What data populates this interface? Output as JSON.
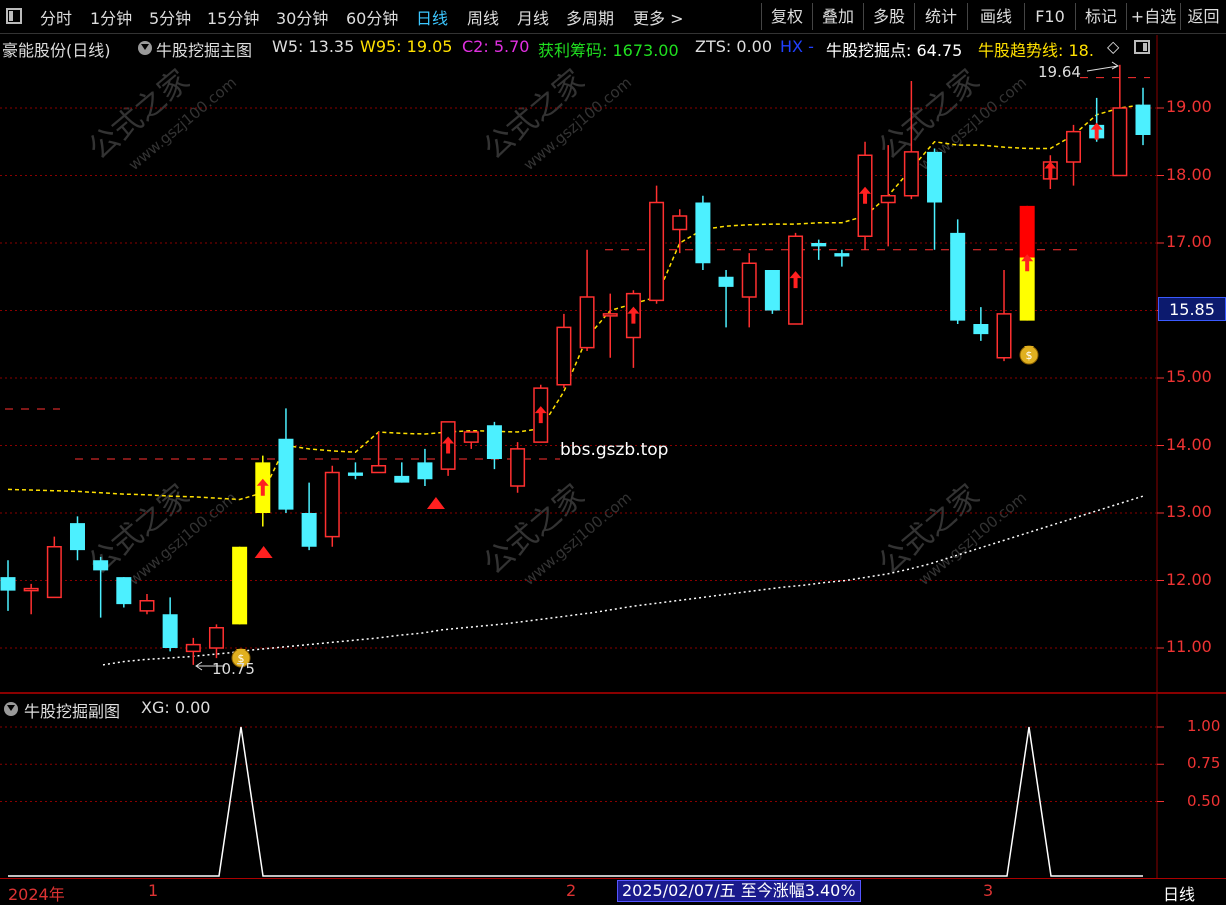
{
  "toolbar": {
    "periods": [
      "分时",
      "1分钟",
      "5分钟",
      "15分钟",
      "30分钟",
      "60分钟",
      "日线",
      "周线",
      "月线",
      "多周期",
      "更多 >"
    ],
    "active_period": "日线",
    "actions": [
      "复权",
      "叠加",
      "多股",
      "统计",
      "画线",
      "F10",
      "标记",
      "+自选",
      "返回"
    ]
  },
  "info": {
    "stock": "豪能股份(日线)",
    "main_indicator": "牛股挖掘主图",
    "w5": "W5: 13.35",
    "w95": "W95: 19.05",
    "c2": "C2: 5.70",
    "profit": "获利筹码: 1673.00",
    "zts": "ZTS: 0.00",
    "hx": "HX -",
    "dig_point": "牛股挖掘点: 64.75",
    "trend_line": "牛股趋势线: 18.",
    "diamond": "◇"
  },
  "sub": {
    "indicator": "牛股挖掘副图",
    "xg": "XG: 0.00"
  },
  "price_tag": "15.85",
  "watermark_url": "bbs.gszb.top",
  "watermark_text": [
    "公式之家",
    "www.gszj100.com"
  ],
  "main_axis_labels": [
    "19.00",
    "18.00",
    "17.00",
    "15.00",
    "14.00",
    "13.00",
    "12.00",
    "11.00"
  ],
  "sub_axis_labels": [
    "1.00",
    "0.75",
    "0.50"
  ],
  "date_bar": {
    "labels": [
      "2024年",
      "1",
      "2",
      "3"
    ],
    "highlight": "2025/02/07/五  至今涨幅3.40%",
    "period": "日线"
  },
  "annotations": {
    "high_label": "19.64",
    "low_label": "10.75"
  },
  "colors": {
    "up": "#ff3030",
    "down": "#4cf0ff",
    "signal_top": "#ff0000",
    "signal_bottom": "#ffff00",
    "ma_yellow": "#ffe000",
    "ma_white": "#ffffff",
    "grid": "#8a0000"
  },
  "chart_data": [
    {
      "type": "candlestick",
      "title": "豪能股份(日线)",
      "ylim": [
        10.5,
        19.6
      ],
      "candles": [
        {
          "o": 12.05,
          "h": 12.3,
          "l": 11.55,
          "c": 11.85
        },
        {
          "o": 11.85,
          "h": 11.95,
          "l": 11.5,
          "c": 11.88
        },
        {
          "o": 11.75,
          "h": 12.65,
          "l": 11.75,
          "c": 12.5
        },
        {
          "o": 12.85,
          "h": 12.95,
          "l": 12.3,
          "c": 12.45
        },
        {
          "o": 12.3,
          "h": 12.35,
          "l": 11.45,
          "c": 12.15
        },
        {
          "o": 12.05,
          "h": 12.05,
          "l": 11.6,
          "c": 11.65
        },
        {
          "o": 11.55,
          "h": 11.8,
          "l": 11.5,
          "c": 11.7
        },
        {
          "o": 11.5,
          "h": 11.75,
          "l": 10.95,
          "c": 11.0
        },
        {
          "o": 10.95,
          "h": 11.15,
          "l": 10.75,
          "c": 11.05
        },
        {
          "o": 11.0,
          "h": 11.35,
          "l": 10.85,
          "c": 11.3
        },
        {
          "o": 11.35,
          "h": 12.5,
          "l": 11.35,
          "c": 12.5,
          "signal": "yellow"
        },
        {
          "o": 13.0,
          "h": 13.85,
          "l": 12.8,
          "c": 13.75,
          "signal": "yellow"
        },
        {
          "o": 14.1,
          "h": 14.55,
          "l": 13.0,
          "c": 13.05
        },
        {
          "o": 13.0,
          "h": 13.45,
          "l": 12.45,
          "c": 12.5
        },
        {
          "o": 12.65,
          "h": 13.7,
          "l": 12.5,
          "c": 13.6
        },
        {
          "o": 13.6,
          "h": 13.75,
          "l": 13.5,
          "c": 13.55
        },
        {
          "o": 13.6,
          "h": 14.2,
          "l": 13.6,
          "c": 13.7
        },
        {
          "o": 13.55,
          "h": 13.75,
          "l": 13.45,
          "c": 13.45
        },
        {
          "o": 13.75,
          "h": 13.95,
          "l": 13.4,
          "c": 13.5
        },
        {
          "o": 13.65,
          "h": 14.35,
          "l": 13.55,
          "c": 14.35
        },
        {
          "o": 14.05,
          "h": 14.2,
          "l": 13.95,
          "c": 14.2
        },
        {
          "o": 14.3,
          "h": 14.35,
          "l": 13.65,
          "c": 13.8
        },
        {
          "o": 13.4,
          "h": 14.05,
          "l": 13.3,
          "c": 13.95
        },
        {
          "o": 14.05,
          "h": 14.9,
          "l": 14.05,
          "c": 14.85
        },
        {
          "o": 14.9,
          "h": 15.95,
          "l": 14.85,
          "c": 15.75
        },
        {
          "o": 15.45,
          "h": 16.9,
          "l": 15.4,
          "c": 16.2
        },
        {
          "o": 15.95,
          "h": 16.25,
          "l": 15.3,
          "c": 15.95
        },
        {
          "o": 15.6,
          "h": 16.3,
          "l": 15.15,
          "c": 16.25
        },
        {
          "o": 16.15,
          "h": 17.85,
          "l": 16.1,
          "c": 17.6
        },
        {
          "o": 17.2,
          "h": 17.5,
          "l": 16.85,
          "c": 17.4
        },
        {
          "o": 17.6,
          "h": 17.7,
          "l": 16.6,
          "c": 16.7
        },
        {
          "o": 16.5,
          "h": 16.6,
          "l": 15.75,
          "c": 16.35
        },
        {
          "o": 16.2,
          "h": 16.85,
          "l": 15.75,
          "c": 16.7
        },
        {
          "o": 16.6,
          "h": 16.6,
          "l": 15.95,
          "c": 16.0
        },
        {
          "o": 15.8,
          "h": 17.15,
          "l": 15.8,
          "c": 17.1
        },
        {
          "o": 17.0,
          "h": 17.05,
          "l": 16.75,
          "c": 16.95
        },
        {
          "o": 16.85,
          "h": 16.9,
          "l": 16.65,
          "c": 16.8
        },
        {
          "o": 17.1,
          "h": 18.5,
          "l": 16.9,
          "c": 18.3
        },
        {
          "o": 17.6,
          "h": 18.45,
          "l": 16.95,
          "c": 17.7
        },
        {
          "o": 17.7,
          "h": 19.4,
          "l": 17.65,
          "c": 18.35
        },
        {
          "o": 18.35,
          "h": 18.4,
          "l": 16.9,
          "c": 17.6
        },
        {
          "o": 17.15,
          "h": 17.35,
          "l": 15.8,
          "c": 15.85
        },
        {
          "o": 15.8,
          "h": 16.05,
          "l": 15.55,
          "c": 15.65
        },
        {
          "o": 15.3,
          "h": 16.6,
          "l": 15.25,
          "c": 15.95
        },
        {
          "o": 15.85,
          "h": 17.55,
          "l": 15.85,
          "c": 17.55,
          "signal": "red-yellow"
        },
        {
          "o": 17.95,
          "h": 18.3,
          "l": 17.8,
          "c": 18.2
        },
        {
          "o": 18.2,
          "h": 18.75,
          "l": 17.85,
          "c": 18.65
        },
        {
          "o": 18.75,
          "h": 19.15,
          "l": 18.5,
          "c": 18.55
        },
        {
          "o": 18.0,
          "h": 19.64,
          "l": 18.0,
          "c": 19.0
        },
        {
          "o": 19.05,
          "h": 19.3,
          "l": 18.45,
          "c": 18.6
        }
      ],
      "yellow_ma": [
        13.35,
        13.34,
        13.33,
        13.32,
        13.3,
        13.28,
        13.27,
        13.25,
        13.24,
        13.22,
        13.2,
        13.3,
        14.0,
        13.95,
        13.92,
        13.9,
        14.2,
        14.18,
        14.17,
        14.2,
        14.22,
        14.21,
        14.2,
        14.25,
        14.8,
        15.6,
        16.0,
        16.1,
        16.2,
        17.0,
        17.2,
        17.25,
        17.27,
        17.28,
        17.28,
        17.3,
        17.3,
        17.4,
        17.7,
        18.1,
        18.5,
        18.45,
        18.45,
        18.42,
        18.4,
        18.4,
        18.6,
        18.9,
        19.0,
        19.05
      ],
      "white_ma": [
        10.75,
        10.8,
        10.83,
        10.85,
        10.87,
        10.9,
        10.93,
        10.97,
        11.0,
        11.03,
        11.06,
        11.09,
        11.12,
        11.15,
        11.19,
        11.22,
        11.27,
        11.3,
        11.33,
        11.36,
        11.4,
        11.44,
        11.48,
        11.52,
        11.57,
        11.62,
        11.66,
        11.7,
        11.74,
        11.78,
        11.82,
        11.86,
        11.9,
        11.93,
        11.97,
        12.0,
        12.05,
        12.1,
        12.17,
        12.25,
        12.35,
        12.45,
        12.55,
        12.65,
        12.75,
        12.85,
        12.95,
        13.05,
        13.15,
        13.25
      ],
      "up_arrows": [
        11,
        19,
        23,
        27,
        34,
        37,
        44,
        45,
        47
      ],
      "red_triangles": [
        10,
        18
      ],
      "moneybags": [
        9,
        44
      ]
    },
    {
      "type": "line",
      "title": "牛股挖掘副图",
      "ylim": [
        0,
        1.1
      ],
      "series": [
        {
          "name": "XG",
          "values": [
            0,
            0,
            0,
            0,
            0,
            0,
            0,
            0,
            0,
            0,
            1,
            0,
            0,
            0,
            0,
            0,
            0,
            0,
            0,
            0,
            0,
            0,
            0,
            0,
            0,
            0,
            0,
            0,
            0,
            0,
            0,
            0,
            0,
            0,
            0,
            0,
            0,
            0,
            0,
            0,
            0,
            0,
            0,
            0,
            1,
            0,
            0,
            0,
            0,
            0
          ]
        }
      ]
    }
  ]
}
